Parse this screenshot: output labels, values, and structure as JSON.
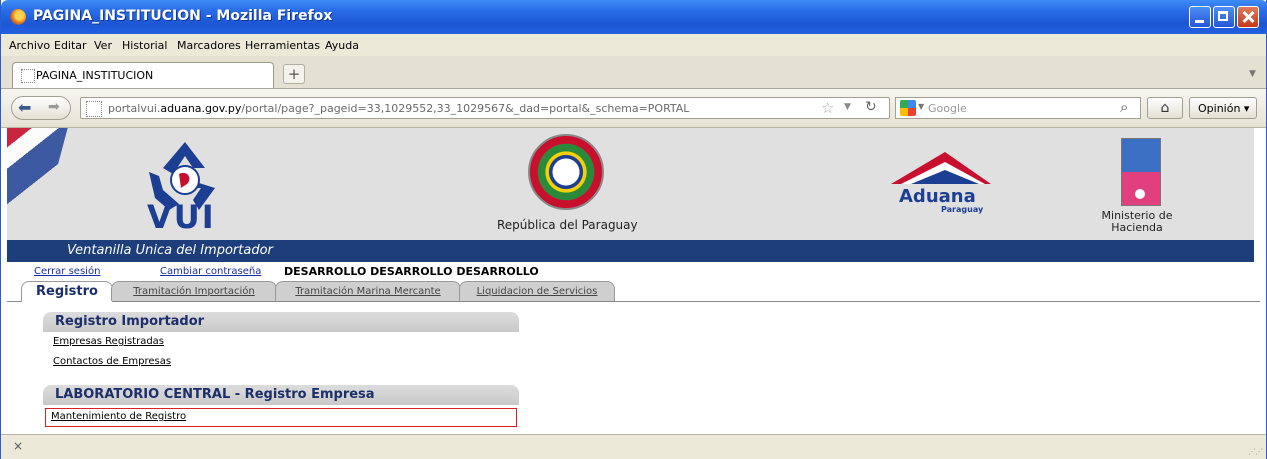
{
  "window": {
    "title": "PAGINA_INSTITUCION - Mozilla Firefox"
  },
  "menu": [
    "Archivo",
    "Editar",
    "Ver",
    "Historial",
    "Marcadores",
    "Herramientas",
    "Ayuda"
  ],
  "browser_tab": {
    "label": "PAGINA_INSTITUCION",
    "new_tab": "+"
  },
  "nav": {
    "url_prefix": "portalvui.",
    "url_domain": "aduana.gov.py",
    "url_rest": "/portal/page?_pageid=33,1029552,33_1029567&_dad=portal&_schema=PORTAL",
    "search_placeholder": "Google",
    "opinion_label": "Opinión"
  },
  "header": {
    "vui_label": "VUI",
    "republic_label": "República del Paraguay",
    "aduana_label": "Aduana",
    "aduana_sub": "Paraguay",
    "ministry_label": "Ministerio de Hacienda",
    "subtitle": "Ventanilla Unica del Importador"
  },
  "user": {
    "logout_label": "Cerrar sesión",
    "change_password_label": "Cambiar contraseña",
    "username": "DESARROLLO DESARROLLO DESARROLLO"
  },
  "app_tabs": [
    {
      "label": "Registro",
      "active": true
    },
    {
      "label": "Tramitación Importación",
      "active": false
    },
    {
      "label": "Tramitación Marina Mercante",
      "active": false
    },
    {
      "label": "Liquidacion de Servicios",
      "active": false
    }
  ],
  "sections": [
    {
      "title": "Registro Importador",
      "links": [
        "Empresas Registradas",
        "Contactos de Empresas"
      ]
    },
    {
      "title": "LABORATORIO CENTRAL - Registro Empresa",
      "links": [
        "Mantenimiento de Registro"
      ]
    }
  ],
  "status": {
    "close_symbol": "×"
  }
}
